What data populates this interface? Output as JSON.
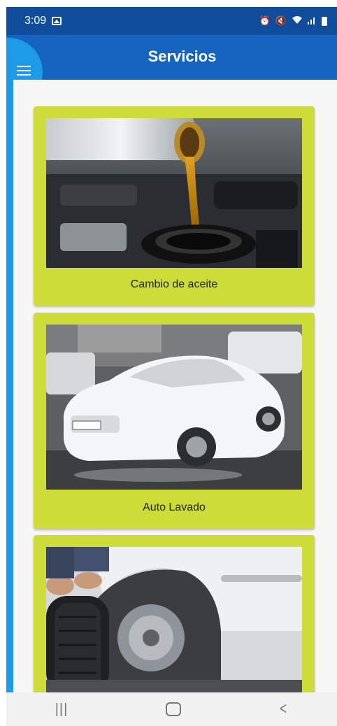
{
  "status_bar": {
    "time": "3:09",
    "icons": [
      "gallery-icon",
      "alarm-icon",
      "mute-icon",
      "wifi-icon",
      "signal-icon",
      "battery-icon"
    ]
  },
  "app_bar": {
    "title": "Servicios",
    "menu_icon": "hamburger-menu-icon"
  },
  "services": [
    {
      "label": "Cambio de aceite",
      "image": "oil-change-photo"
    },
    {
      "label": "Auto Lavado",
      "image": "car-wash-photo"
    },
    {
      "label": "",
      "image": "tire-change-photo"
    }
  ],
  "nav_bar": {
    "recents_icon": "recents-icon",
    "home_icon": "home-icon",
    "back_icon": "back-icon"
  },
  "colors": {
    "status_bar": "#0f4c9c",
    "app_bar": "#1565c0",
    "accent_rail": "#1e9be8",
    "card": "#cddc39",
    "background": "#f7f7f7"
  }
}
